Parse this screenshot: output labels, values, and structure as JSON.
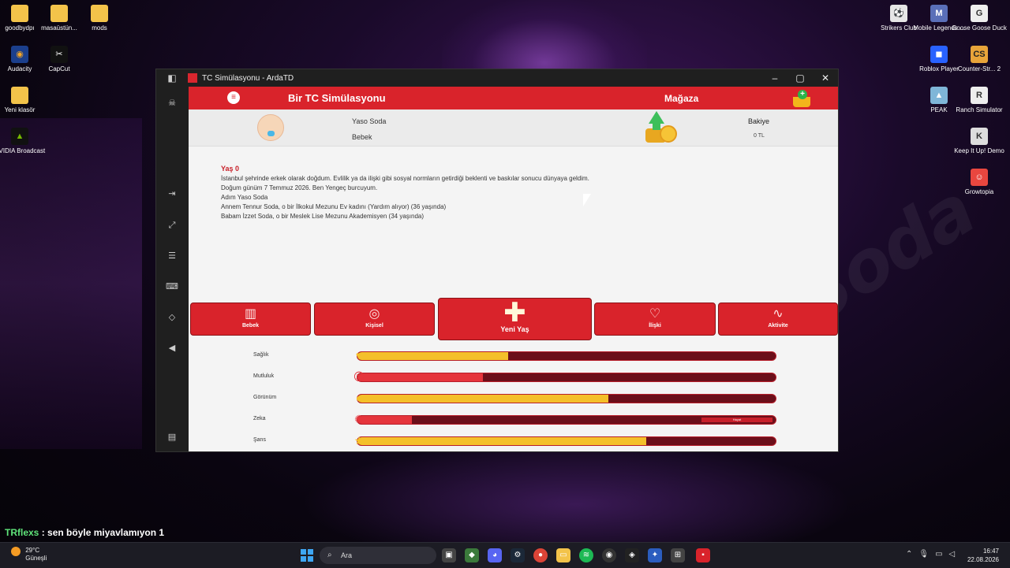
{
  "desktop": {
    "left_icons": [
      {
        "label": "goodbydpı",
        "icon": "folder-icon"
      },
      {
        "label": "masaüstün...",
        "icon": "folder-icon"
      },
      {
        "label": "mods",
        "icon": "folder-icon"
      },
      {
        "label": "Audacity",
        "icon": "audacity-icon"
      },
      {
        "label": "CapCut",
        "icon": "capcut-icon"
      },
      {
        "label": "Yeni klasör",
        "icon": "folder-icon"
      },
      {
        "label": "NVIDIA Broadcast",
        "icon": "nvidia-icon"
      }
    ],
    "right_icons": [
      {
        "label": "Strikers Club",
        "icon": "game-icon"
      },
      {
        "label": "Mobile Legends ...",
        "icon": "game-icon"
      },
      {
        "label": "Goose Goose Duck",
        "icon": "game-icon"
      },
      {
        "label": "Roblox Player",
        "icon": "roblox-icon"
      },
      {
        "label": "Counter-Str... 2",
        "icon": "game-icon"
      },
      {
        "label": "PEAK",
        "icon": "game-icon"
      },
      {
        "label": "Ranch Simulator",
        "icon": "game-icon"
      },
      {
        "label": "Keep It Up! Demo",
        "icon": "game-icon"
      },
      {
        "label": "Growtopia",
        "icon": "game-icon"
      }
    ]
  },
  "window": {
    "title": "TC Simülasyonu - ArdaTD",
    "minimize": "–",
    "maximize": "▢",
    "close": "✕"
  },
  "app": {
    "header": {
      "title": "Bir TC Simülasyonu",
      "shop_label": "Mağaza"
    },
    "profile": {
      "name": "Yaso Soda",
      "stage": "Bebek",
      "balance_label": "Bakiye",
      "balance_value": "0 TL"
    },
    "story": {
      "age_title": "Yaş 0",
      "lines": [
        "İstanbul şehrinde erkek olarak doğdum. Evlilik ya da ilişki gibi sosyal normların getirdiği beklenti ve baskılar sonucu dünyaya geldim.",
        "Doğum günüm 7 Temmuz 2026. Ben Yengeç burcuyum.",
        "Adım Yaso Soda",
        "Annem Tennur Soda, o bir İlkokul Mezunu Ev kadını (Yardım alıyor) (36 yaşında)",
        "Babam İzzet Soda, o bir Meslek Lise Mezunu Akademisyen (34 yaşında)"
      ]
    },
    "actions": [
      {
        "label": "Bebek",
        "icon": "book-icon"
      },
      {
        "label": "Kişisel",
        "icon": "person-icon"
      },
      {
        "label": "Yeni Yaş",
        "icon": "plus-icon"
      },
      {
        "label": "İlişki",
        "icon": "heart-icon"
      },
      {
        "label": "Aktivite",
        "icon": "pulse-icon"
      }
    ],
    "stats": [
      {
        "label": "Sağlık",
        "icon": "heart-icon",
        "value": 0.36,
        "color": "#f4c02a"
      },
      {
        "label": "Mutluluk",
        "icon": "face-icon",
        "value": 0.3,
        "color": "#e5353c"
      },
      {
        "label": "Görünüm",
        "icon": "person-icon",
        "value": 0.6,
        "color": "#f4c02a"
      },
      {
        "label": "Zeka",
        "icon": "brain-icon",
        "value": 0.13,
        "color": "#e5353c",
        "tag": "Hayat"
      },
      {
        "label": "Şans",
        "icon": "star-icon",
        "value": 0.69,
        "color": "#f4c02a"
      }
    ]
  },
  "chat": {
    "user": "TRflexs",
    "message": " : sen böyle miyavlamıyon 1"
  },
  "taskbar": {
    "weather_temp": "29°C",
    "weather_desc": "Güneşli",
    "search_placeholder": "Ara",
    "time": "16:47",
    "date": "22.08.2026"
  }
}
